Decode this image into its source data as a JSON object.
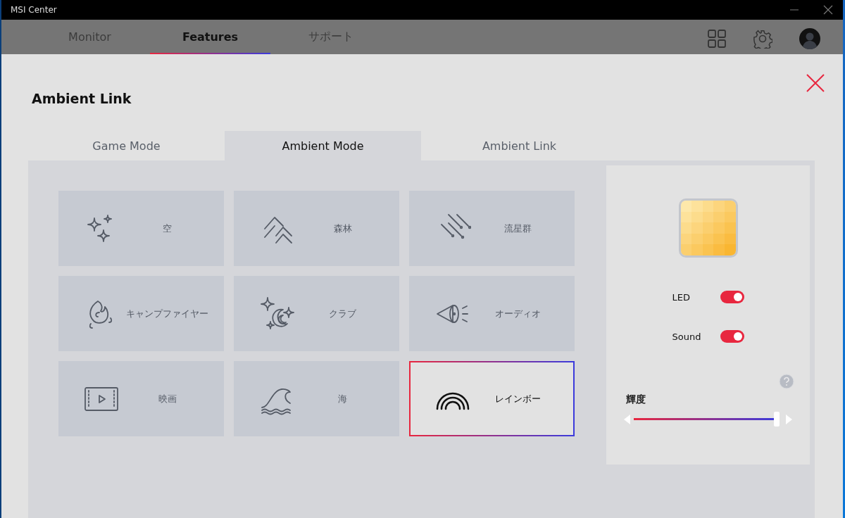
{
  "window": {
    "title": "MSI Center"
  },
  "nav_tabs": [
    {
      "label": "Monitor",
      "selected": false
    },
    {
      "label": "Features",
      "selected": true
    },
    {
      "label": "サポート",
      "selected": false
    }
  ],
  "page_title": "Ambient Link",
  "mode_tabs": [
    {
      "label": "Game Mode",
      "selected": false
    },
    {
      "label": "Ambient Mode",
      "selected": true
    },
    {
      "label": "Ambient Link",
      "selected": false
    }
  ],
  "effects": [
    {
      "label": "空",
      "selected": false
    },
    {
      "label": "森林",
      "selected": false
    },
    {
      "label": "流星群",
      "selected": false
    },
    {
      "label": "キャンプファイヤー",
      "selected": false
    },
    {
      "label": "クラブ",
      "selected": false
    },
    {
      "label": "オーディオ",
      "selected": false
    },
    {
      "label": "映画",
      "selected": false
    },
    {
      "label": "海",
      "selected": false
    },
    {
      "label": "レインボー",
      "selected": true
    }
  ],
  "settings": {
    "toggles": [
      {
        "label": "LED",
        "on": true
      },
      {
        "label": "Sound",
        "on": true
      }
    ],
    "brightness": {
      "label": "輝度",
      "level": 0.98
    }
  }
}
